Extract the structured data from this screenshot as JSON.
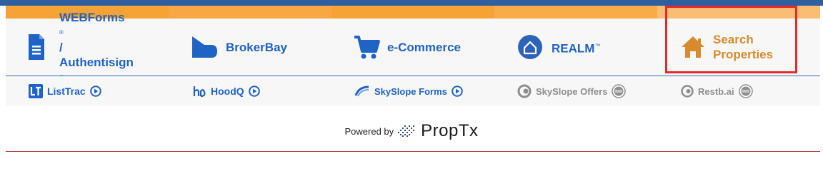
{
  "header": {
    "accent_colors": {
      "blue": "#2f5f9e",
      "orange": "#f7a234",
      "nav_blue": "#1f63c4",
      "search_orange": "#d98a2e",
      "highlight_red": "#e52a2a"
    }
  },
  "nav": {
    "items": [
      {
        "line1": "WEBForms",
        "mark1": "®",
        "line1_suffix": "/",
        "line2": "Authentisign",
        "mark2": "®",
        "icon": "document-icon"
      },
      {
        "label": "BrokerBay",
        "icon": "brokerbay-logo-icon"
      },
      {
        "label": "e-Commerce",
        "icon": "shopping-cart-icon"
      },
      {
        "label": "REALM",
        "mark": "™",
        "icon": "realm-house-icon"
      },
      {
        "line1": "Search",
        "line2": "Properties",
        "icon": "home-icon"
      }
    ]
  },
  "subnav": {
    "items": [
      {
        "label": "ListTrac",
        "icon": "listtrac-logo-icon",
        "action_icon": "play-circle-icon"
      },
      {
        "label": "HoodQ",
        "icon": "hoodq-logo-icon",
        "action_icon": "play-circle-icon"
      },
      {
        "label": "SkySlope Forms",
        "icon": "skyslope-logo-icon",
        "action_icon": "play-circle-icon"
      },
      {
        "label": "SkySlope Offers",
        "icon": "skyslope-offers-logo-icon",
        "badge_icon": "coming-soon-badge-icon"
      },
      {
        "label": "Restb.ai",
        "icon": "restb-logo-icon",
        "badge_icon": "coming-soon-badge-icon"
      }
    ]
  },
  "footer": {
    "powered_by": "Powered by",
    "brand": "PropTx",
    "brand_icon": "proptx-logo-icon"
  }
}
